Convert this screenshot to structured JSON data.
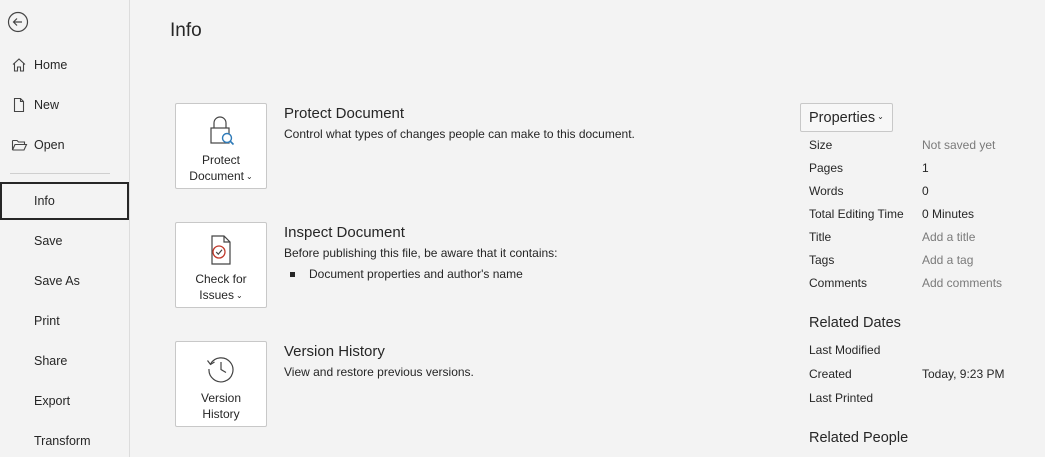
{
  "sidebar": {
    "items": [
      {
        "label": "Home"
      },
      {
        "label": "New"
      },
      {
        "label": "Open"
      },
      {
        "label": "Info"
      },
      {
        "label": "Save"
      },
      {
        "label": "Save As"
      },
      {
        "label": "Print"
      },
      {
        "label": "Share"
      },
      {
        "label": "Export"
      },
      {
        "label": "Transform"
      }
    ]
  },
  "main": {
    "title": "Info",
    "protect": {
      "card_line1": "Protect",
      "card_line2": "Document",
      "title": "Protect Document",
      "desc": "Control what types of changes people can make to this document."
    },
    "inspect": {
      "card_line1": "Check for",
      "card_line2": "Issues",
      "title": "Inspect Document",
      "desc": "Before publishing this file, be aware that it contains:",
      "bullet": "Document properties and author's name"
    },
    "version": {
      "card_line1": "Version",
      "card_line2": "History",
      "title": "Version History",
      "desc": "View and restore previous versions."
    }
  },
  "properties": {
    "button_label": "Properties",
    "rows": [
      {
        "key": "Size",
        "value": "Not saved yet"
      },
      {
        "key": "Pages",
        "value": "1"
      },
      {
        "key": "Words",
        "value": "0"
      },
      {
        "key": "Total Editing Time",
        "value": "0 Minutes"
      },
      {
        "key": "Title",
        "value": "Add a title"
      },
      {
        "key": "Tags",
        "value": "Add a tag"
      },
      {
        "key": "Comments",
        "value": "Add comments"
      }
    ],
    "related_dates": {
      "title": "Related Dates",
      "rows": [
        {
          "key": "Last Modified",
          "value": ""
        },
        {
          "key": "Created",
          "value": "Today, 9:23 PM"
        },
        {
          "key": "Last Printed",
          "value": ""
        }
      ]
    },
    "related_people": {
      "title": "Related People"
    }
  },
  "icons": {
    "back": "back-arrow-icon",
    "home": "home-icon",
    "new": "new-document-icon",
    "open": "open-folder-icon"
  }
}
